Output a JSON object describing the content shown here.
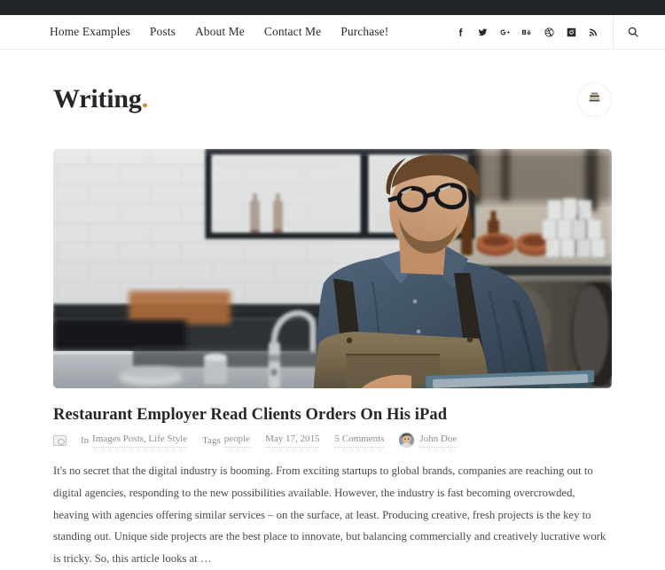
{
  "topbar": {
    "present": true,
    "color": "#22252a"
  },
  "nav": {
    "items": [
      {
        "label": "Home Examples",
        "name": "nav-home-examples"
      },
      {
        "label": "Posts",
        "name": "nav-posts"
      },
      {
        "label": "About Me",
        "name": "nav-about-me"
      },
      {
        "label": "Contact Me",
        "name": "nav-contact-me"
      },
      {
        "label": "Purchase!",
        "name": "nav-purchase"
      }
    ],
    "social": [
      {
        "icon": "facebook-icon",
        "label": "Facebook"
      },
      {
        "icon": "twitter-icon",
        "label": "Twitter"
      },
      {
        "icon": "google-plus-icon",
        "label": "Google Plus"
      },
      {
        "icon": "behance-icon",
        "label": "Behance"
      },
      {
        "icon": "dribbble-icon",
        "label": "Dribbble"
      },
      {
        "icon": "instagram-icon",
        "label": "Instagram"
      },
      {
        "icon": "rss-icon",
        "label": "RSS"
      }
    ],
    "search": {
      "icon": "search-icon",
      "label": "Search"
    }
  },
  "header": {
    "logo_text": "Writing",
    "logo_dot": ".",
    "accent_color": "#e8891f",
    "action_button": {
      "icon": "menu-stack-icon",
      "label": "Menu"
    }
  },
  "hero": {
    "alt": "Barista in denim shirt and leather apron using a tablet behind a cafe counter",
    "caption": ""
  },
  "post": {
    "title": "Restaurant Employer Read Clients Orders On His iPad",
    "meta": {
      "format_icon": "image-format-icon",
      "categories_lead": "In",
      "categories": "Images Posts, Life Style",
      "tags_lead": "Tags",
      "tags": "people",
      "date": "May 17, 2015",
      "comments": "5 Comments",
      "author": "John Doe",
      "author_avatar": "avatar"
    },
    "excerpt": "It's no secret that the digital industry is booming. From exciting startups to global brands, companies are reaching out to digital agencies, responding to the new possibilities available. However, the industry is fast becoming overcrowded, heaving with agencies offering similar services – on the surface, at least. Producing creative, fresh projects is the key to standing out. Unique side projects are the best place to innovate, but balancing commercially and creatively lucrative work is tricky. So, this article looks at …"
  }
}
